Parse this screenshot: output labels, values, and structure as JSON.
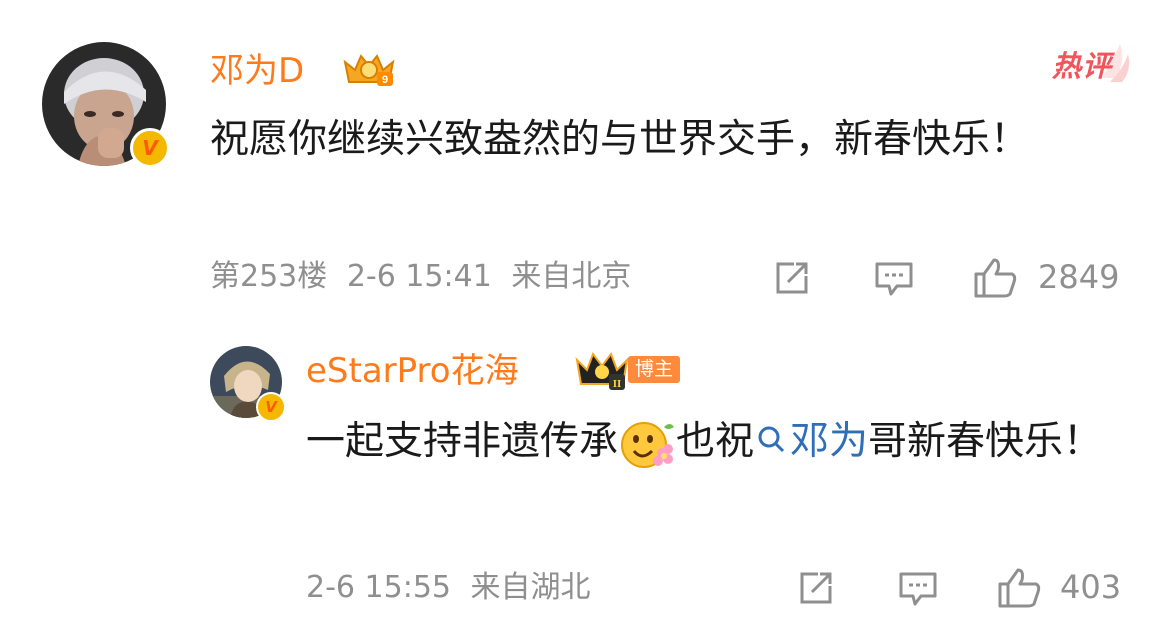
{
  "comment": {
    "username": "邓为D",
    "crown_level": "9",
    "hot_label": "热评",
    "text": "祝愿你继续兴致盎然的与世界交手，新春快乐！",
    "floor": "第253楼",
    "date": "2-6 15:41",
    "location": "来自北京",
    "like_count": "2849",
    "verified_mark": "V"
  },
  "reply": {
    "username": "eStarPro花海",
    "crown_level": "II",
    "owner_tag": "博主",
    "text_before": "一起支持非遗传承",
    "text_mid": "也祝",
    "mention": "邓为",
    "text_after": "哥新春快乐！",
    "date": "2-6 15:55",
    "location": "来自湖北",
    "like_count": "403",
    "verified_mark": "V"
  },
  "colors": {
    "username": "#ff7a1a",
    "hot_label": "#f2545b",
    "mention": "#2e6fb8",
    "meta": "#8f8f8f",
    "owner_tag": "#ff8a3c"
  }
}
